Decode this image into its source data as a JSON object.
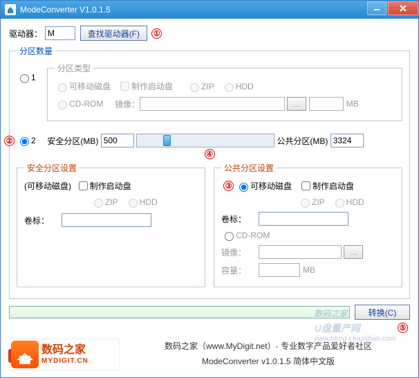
{
  "window": {
    "title": "ModeConverter V1.0.1.5"
  },
  "marks": {
    "m1": "①",
    "m2": "②",
    "m3": "③",
    "m4": "④",
    "m5": "⑤"
  },
  "drive": {
    "label": "驱动器：",
    "value": "M",
    "find_btn": "查找驱动器(F)"
  },
  "partition_count": {
    "legend": "分区数量",
    "opt1": "1",
    "opt2": "2"
  },
  "part_type": {
    "legend": "分区类型",
    "removable": "可移动磁盘",
    "make_boot": "制作启动盘",
    "zip": "ZIP",
    "hdd": "HDD",
    "cdrom": "CD-ROM",
    "image": "镜像：",
    "mb": "MB"
  },
  "sizes": {
    "secure_lbl": "安全分区(MB)",
    "secure_val": "500",
    "public_lbl": "公共分区(MB)",
    "public_val": "3324"
  },
  "secure_cfg": {
    "legend": "安全分区设置",
    "sub": "(可移动磁盘)",
    "make_boot": "制作启动盘",
    "zip": "ZIP",
    "hdd": "HDD",
    "vol_label": "卷标："
  },
  "public_cfg": {
    "legend": "公共分区设置",
    "removable": "可移动磁盘",
    "make_boot": "制作启动盘",
    "zip": "ZIP",
    "hdd": "HDD",
    "vol_label": "卷标：",
    "cdrom": "CD-ROM",
    "image": "镜像：",
    "capacity": "容量：",
    "mb": "MB"
  },
  "convert_btn": "转换(C)",
  "logo": {
    "brand": "数码之家",
    "domain": "MYDIGIT.CN"
  },
  "footer": {
    "line1": "数码之家（www.MyDigit.net）- 专业数字产品爱好者社区",
    "line2": "ModeConverter v1.0.1.5 简体中文版"
  },
  "watermark": {
    "main": "数码之家",
    "sub1": "U盘量产网",
    "sub2": "jiaocheng.chazidian.com"
  }
}
